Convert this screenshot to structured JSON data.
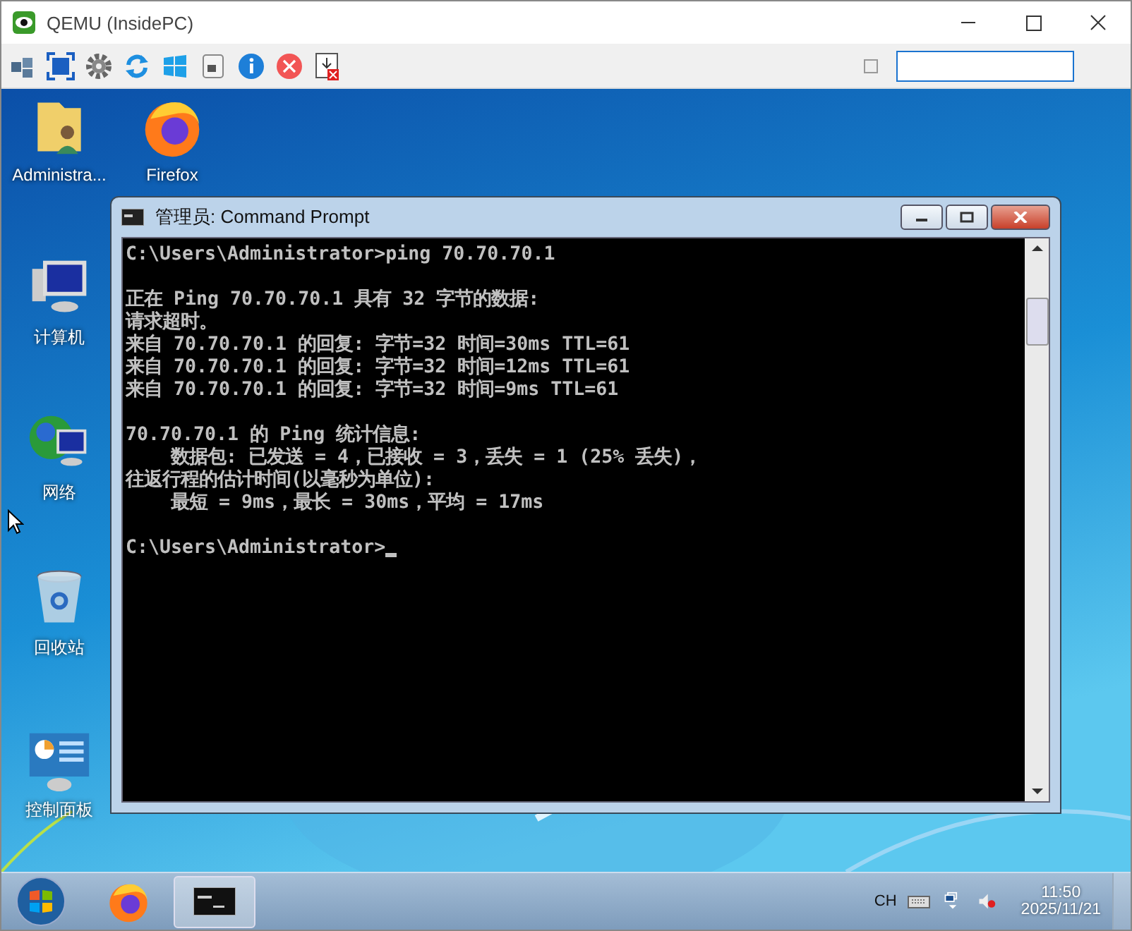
{
  "window": {
    "title": "QEMU (InsidePC)"
  },
  "desktop_icons": [
    {
      "label": "Administra...",
      "kind": "user-folder"
    },
    {
      "label": "Firefox",
      "kind": "firefox"
    },
    {
      "label": "计算机",
      "kind": "computer"
    },
    {
      "label": "网络",
      "kind": "network"
    },
    {
      "label": "回收站",
      "kind": "recycle"
    },
    {
      "label": "控制面板",
      "kind": "control-panel"
    }
  ],
  "console": {
    "title": "管理员: Command Prompt",
    "blocks": [
      [
        "C:\\Users\\Administrator>ping 70.70.70.1"
      ],
      [
        "正在 Ping 70.70.70.1 具有 32 字节的数据:",
        "请求超时。",
        "来自 70.70.70.1 的回复: 字节=32 时间=30ms TTL=61",
        "来自 70.70.70.1 的回复: 字节=32 时间=12ms TTL=61",
        "来自 70.70.70.1 的回复: 字节=32 时间=9ms TTL=61"
      ],
      [
        "70.70.70.1 的 Ping 统计信息:",
        "    数据包: 已发送 = 4，已接收 = 3，丢失 = 1 (25% 丢失)，",
        "往返行程的估计时间(以毫秒为单位):",
        "    最短 = 9ms，最长 = 30ms，平均 = 17ms"
      ],
      [
        "C:\\Users\\Administrator>"
      ]
    ]
  },
  "toolbar_checkbox": {
    "checked": false
  },
  "taskbar": {
    "language": "CH",
    "time": "11:50",
    "date": "2025/11/21"
  }
}
